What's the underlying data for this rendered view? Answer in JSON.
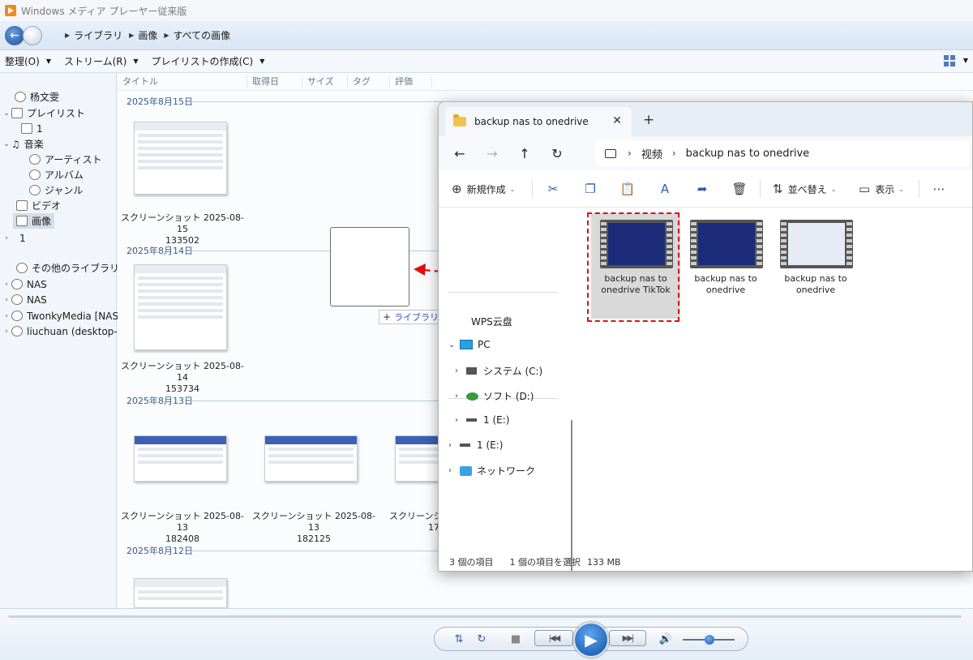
{
  "wmp": {
    "title": "Windows メディア プレーヤー従来版",
    "breadcrumb": [
      "ライブラリ",
      "画像",
      "すべての画像"
    ],
    "toolbar": {
      "organize": "整理(O)",
      "stream": "ストリーム(R)",
      "playlist": "プレイリストの作成(C)"
    },
    "sidebar": {
      "user": "杨文雯",
      "playlists": "プレイリスト",
      "playlist_item": "1",
      "music": "音楽",
      "artist": "アーティスト",
      "album": "アルバム",
      "genre": "ジャンル",
      "video": "ビデオ",
      "pictures": "画像",
      "other_1": "1",
      "other_libraries": "その他のライブラリ",
      "nas1": "NAS",
      "nas2": "NAS",
      "twonky": "TwonkyMedia [NAS]",
      "liuchuan": "liuchuan (desktop-q"
    },
    "columns": [
      "タイトル",
      "取得日",
      "サイズ",
      "タグ",
      "評価"
    ],
    "groups": [
      {
        "date": "2025年8月15日"
      },
      {
        "date": "2025年8月14日"
      },
      {
        "date": "2025年8月13日"
      },
      {
        "date": "2025年8月12日"
      }
    ],
    "items": {
      "i1": {
        "line1": "スクリーンショット 2025-08-15",
        "line2": "133502"
      },
      "i2": {
        "line1": "スクリーンショット 2025-08-14",
        "line2": "153734"
      },
      "i3": {
        "line1": "スクリーンショット 2025-08-13",
        "line2": "182408"
      },
      "i4": {
        "line1": "スクリーンショット 2025-08-13",
        "line2": "182125"
      },
      "i5": {
        "line1": "スクリーンショ",
        "line2": "17"
      }
    },
    "drag_tip": "ライブラリに追加します"
  },
  "explorer": {
    "tab_title": "backup nas to onedrive",
    "address": [
      "视频",
      "backup nas to onedrive"
    ],
    "commands": {
      "new": "新規作成",
      "sort": "並べ替え",
      "view": "表示"
    },
    "nav": {
      "wps": "WPS云盘",
      "pc": "PC",
      "system": "システム (C:)",
      "soft": "ソフト (D:)",
      "e1": "1 (E:)",
      "e2": "1 (E:)",
      "network": "ネットワーク"
    },
    "files": [
      {
        "line1": "backup nas to",
        "line2": "onedrive TikTok"
      },
      {
        "line1": "backup nas to",
        "line2": "onedrive"
      },
      {
        "line1": "backup nas to",
        "line2": "onedrive"
      }
    ],
    "status": {
      "count": "3 個の項目",
      "selected": "1 個の項目を選択",
      "size": "133 MB"
    }
  },
  "colors": {
    "highlight": "#e01010",
    "accent": "#1d4f99"
  }
}
